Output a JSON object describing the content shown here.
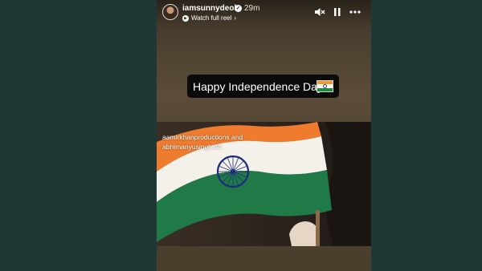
{
  "story": {
    "username": "iamsunnydeol",
    "verified_symbol": "✓",
    "time_ago": "29m",
    "watch_label": "Watch full reel",
    "watch_arrow": "›",
    "controls": {
      "mute_icon": "🔇",
      "pause_icon": "❚❚",
      "more_icon": "•••"
    }
  },
  "sticker": {
    "text": "Happy Independence Day",
    "emoji": "indian-flag-emoji"
  },
  "embedded_reel": {
    "tag_line1": "aamirkhanproductions and",
    "tag_line2": "abhimanyusingh.44"
  },
  "colors": {
    "page_background": "#1f3836",
    "saffron": "#f07a2a",
    "white": "#ffffff",
    "green": "#1e7a45",
    "chakra": "#1f2c7a"
  }
}
